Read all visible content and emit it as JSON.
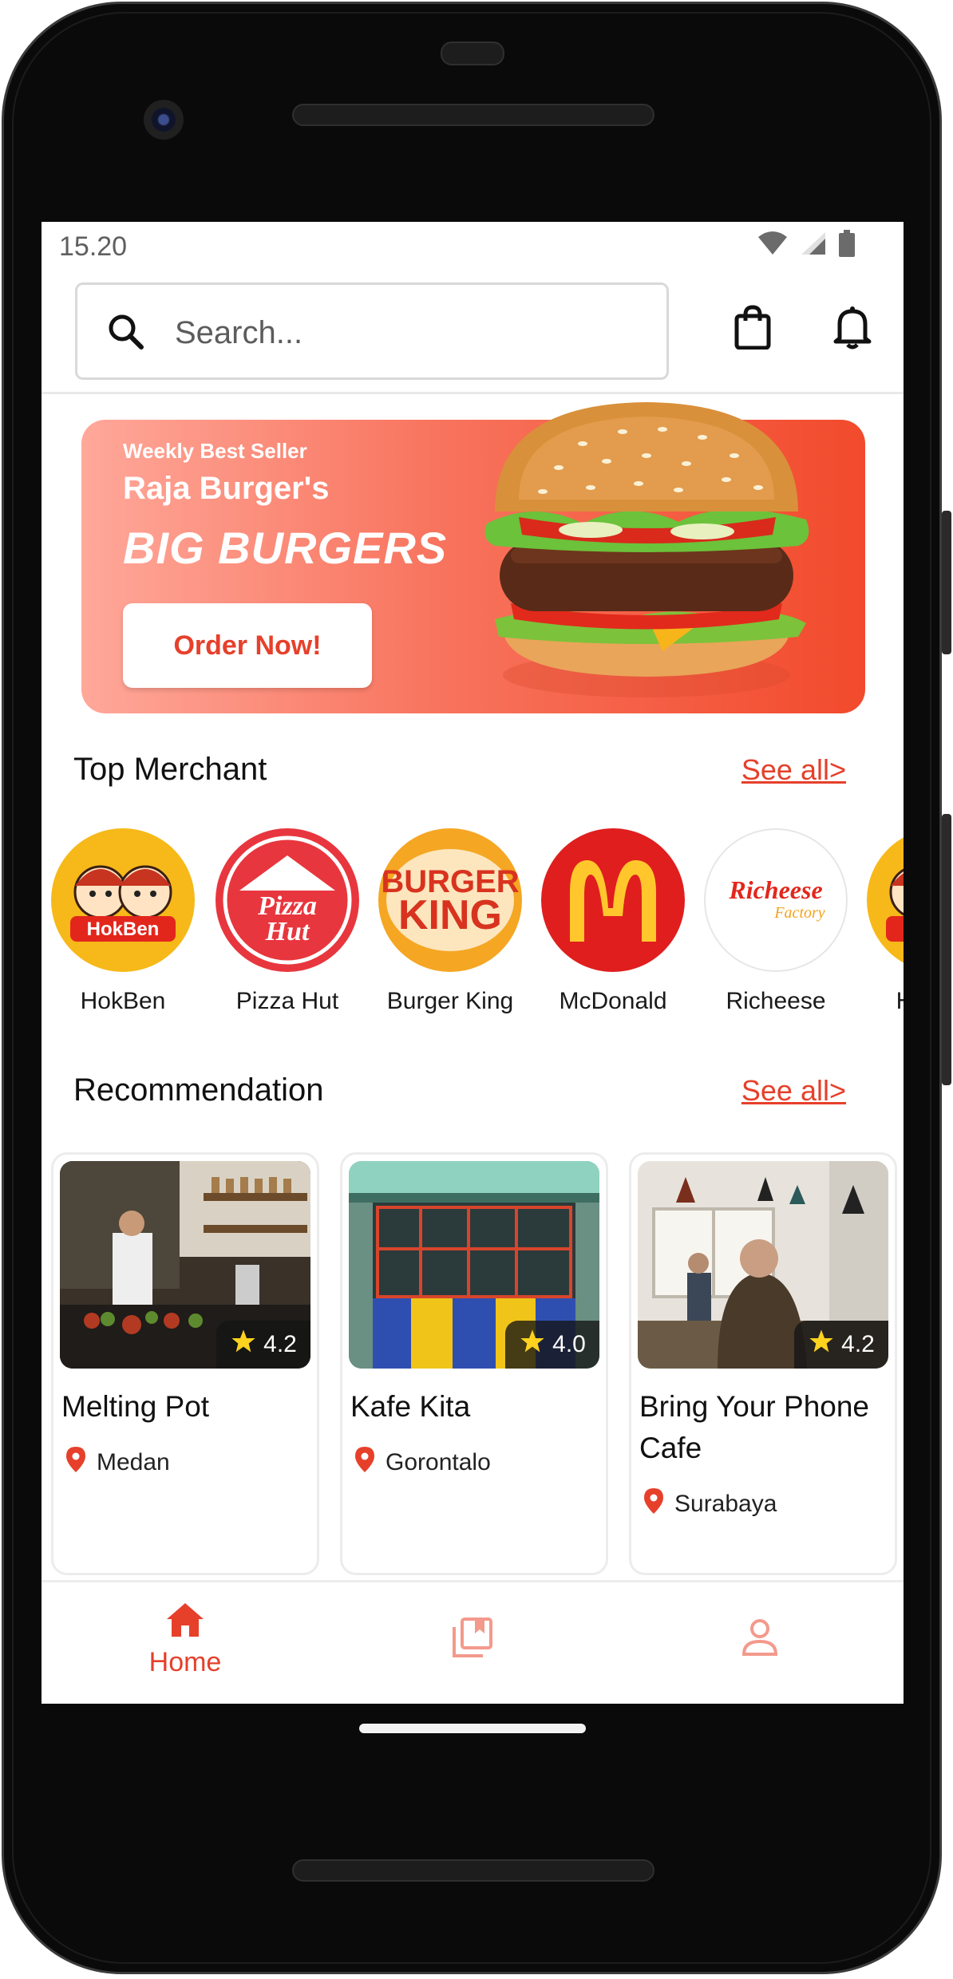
{
  "status_bar": {
    "time": "15.20"
  },
  "search": {
    "placeholder": "Search..."
  },
  "banner": {
    "kicker": "Weekly Best Seller",
    "title": "Raja Burger's",
    "headline": "BIG BURGERS",
    "cta_label": "Order Now!"
  },
  "top_merchant": {
    "title": "Top Merchant",
    "see_all": "See all>",
    "items": [
      {
        "name": "HokBen",
        "logo_text": "HokBen"
      },
      {
        "name": "Pizza Hut",
        "logo_text": "Pizza Hut"
      },
      {
        "name": "Burger King",
        "logo_text": "BURGER KING"
      },
      {
        "name": "McDonald",
        "logo_text": "M"
      },
      {
        "name": "Richeese",
        "logo_text": "Richeese",
        "logo_subtext": "Factory"
      }
    ]
  },
  "recommendation": {
    "title": "Recommendation",
    "see_all": "See all>",
    "items": [
      {
        "name": "Melting Pot",
        "location": "Medan",
        "rating": "4.2"
      },
      {
        "name": "Kafe Kita",
        "location": "Gorontalo",
        "rating": "4.0"
      },
      {
        "name": "Bring Your Phone Cafe",
        "location": "Surabaya",
        "rating": "4.2"
      }
    ]
  },
  "bottom_nav": {
    "items": [
      {
        "label": "Home",
        "icon": "home-icon",
        "active": true
      },
      {
        "label": "",
        "icon": "bookmarks-icon",
        "active": false
      },
      {
        "label": "",
        "icon": "profile-icon",
        "active": false
      }
    ]
  },
  "colors": {
    "accent": "#e6402b",
    "banner_start": "#ffa89a",
    "banner_end": "#f24a2c",
    "nav_inactive": "#f39a8c"
  }
}
